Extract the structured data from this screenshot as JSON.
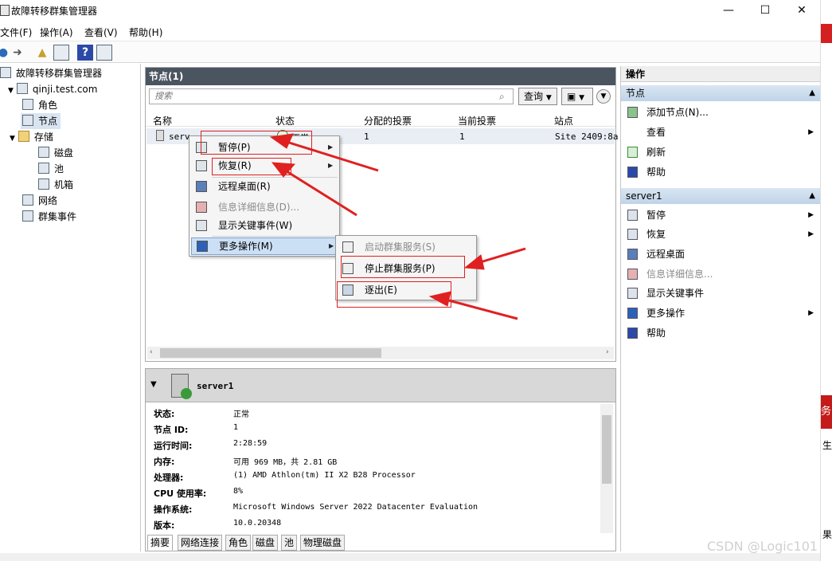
{
  "window": {
    "title": "故障转移群集管理器",
    "minimize": "—",
    "maximize": "☐",
    "close": "✕"
  },
  "menubar": [
    "文件(F)",
    "操作(A)",
    "查看(V)",
    "帮助(H)"
  ],
  "tree": {
    "root": "故障转移群集管理器",
    "cluster": "qinji.test.com",
    "items": [
      "角色",
      "节点",
      "存储",
      "磁盘",
      "池",
      "机箱",
      "网络",
      "群集事件"
    ],
    "selected": "节点"
  },
  "nodes_panel": {
    "title": "节点(1)",
    "search_placeholder": "搜索",
    "query_button": "查询",
    "columns": [
      "名称",
      "状态",
      "分配的投票",
      "当前投票",
      "站点"
    ],
    "row": {
      "name": "serv",
      "status": "正常",
      "assigned_votes": "1",
      "current_votes": "1",
      "site": "Site 2409:8a"
    }
  },
  "context_menu": {
    "items": [
      {
        "label": "暂停(P)",
        "icon": "pause-icon",
        "submenu": true,
        "enabled": true
      },
      {
        "label": "恢复(R)",
        "icon": "resume-icon",
        "submenu": true,
        "enabled": true
      },
      {
        "label": "远程桌面(R)",
        "icon": "remote-desktop-icon",
        "submenu": false,
        "enabled": true
      },
      {
        "label": "信息详细信息(D)...",
        "icon": "info-icon",
        "submenu": false,
        "enabled": false
      },
      {
        "label": "显示关键事件(W)",
        "icon": "events-icon",
        "submenu": false,
        "enabled": true
      },
      {
        "label": "更多操作(M)",
        "icon": "more-actions-icon",
        "submenu": true,
        "enabled": true
      }
    ],
    "submenu": [
      {
        "label": "启动群集服务(S)",
        "enabled": false
      },
      {
        "label": "停止群集服务(P)",
        "enabled": true
      },
      {
        "label": "逐出(E)",
        "enabled": true
      }
    ]
  },
  "detail": {
    "name": "server1",
    "props": [
      {
        "k": "状态:",
        "v": "正常"
      },
      {
        "k": "节点 ID:",
        "v": "1"
      },
      {
        "k": "运行时间:",
        "v": "2:28:59"
      },
      {
        "k": "内存:",
        "v": "可用 969 MB，共 2.81 GB"
      },
      {
        "k": "处理器:",
        "v": "(1) AMD Athlon(tm) II X2 B28 Processor"
      },
      {
        "k": "CPU 使用率:",
        "v": "8%"
      },
      {
        "k": "操作系统:",
        "v": "Microsoft Windows Server 2022 Datacenter Evaluation"
      },
      {
        "k": "版本:",
        "v": "10.0.20348"
      }
    ],
    "tabs": [
      "摘要",
      "网络连接",
      "角色",
      "磁盘",
      "池",
      "物理磁盘"
    ]
  },
  "actions": {
    "header": "操作",
    "section1": "节点",
    "section1_items": [
      {
        "label": "添加节点(N)...",
        "submenu": false
      },
      {
        "label": "查看",
        "submenu": true
      },
      {
        "label": "刷新",
        "submenu": false
      },
      {
        "label": "帮助",
        "submenu": false
      }
    ],
    "section2": "server1",
    "section2_items": [
      {
        "label": "暂停",
        "submenu": true,
        "enabled": true
      },
      {
        "label": "恢复",
        "submenu": true,
        "enabled": true
      },
      {
        "label": "远程桌面",
        "submenu": false,
        "enabled": true
      },
      {
        "label": "信息详细信息...",
        "submenu": false,
        "enabled": false
      },
      {
        "label": "显示关键事件",
        "submenu": false,
        "enabled": true
      },
      {
        "label": "更多操作",
        "submenu": true,
        "enabled": true
      },
      {
        "label": "帮助",
        "submenu": false,
        "enabled": true
      }
    ]
  },
  "side_fragments": [
    "务",
    "生",
    "果"
  ],
  "watermark": "CSDN @Logic101",
  "colors": {
    "accent_red": "#e02020",
    "panel_header": "#4a5560",
    "selection": "#cce0f5"
  }
}
